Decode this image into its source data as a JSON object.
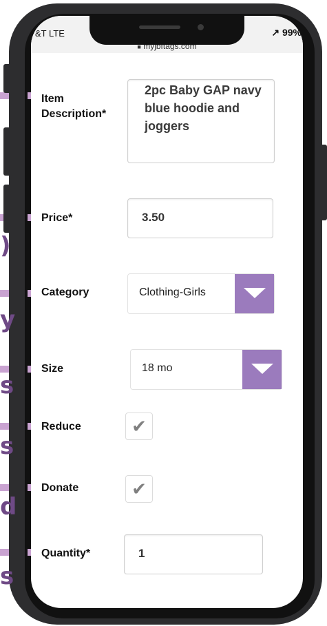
{
  "status_bar": {
    "carrier": "&T  LTE",
    "battery": "↗ 99%",
    "url": "myjbftags.com"
  },
  "annotations": {
    "edge_letters": [
      ")",
      "y",
      "s",
      "s",
      "d",
      "s"
    ]
  },
  "form": {
    "item_description": {
      "label_line1": "Item",
      "label_line2": "Description*",
      "value": "2pc Baby GAP navy blue hoodie and joggers"
    },
    "price": {
      "label": "Price*",
      "value": "3.50"
    },
    "category": {
      "label": "Category",
      "selected": "Clothing-Girls"
    },
    "size": {
      "label": "Size",
      "selected": "18 mo"
    },
    "reduce": {
      "label": "Reduce",
      "checked": true
    },
    "donate": {
      "label": "Donate",
      "checked": true
    },
    "quantity": {
      "label": "Quantity*",
      "value": "1"
    }
  },
  "colors": {
    "accent": "#9b7bbd",
    "leader": "#c9a3d1",
    "phone_frame": "#2d2d2f"
  },
  "icons": {
    "checkmark": "checkmark-icon",
    "dropdown": "chevron-down-icon",
    "lock": "lock-icon",
    "location": "location-arrow-icon"
  }
}
